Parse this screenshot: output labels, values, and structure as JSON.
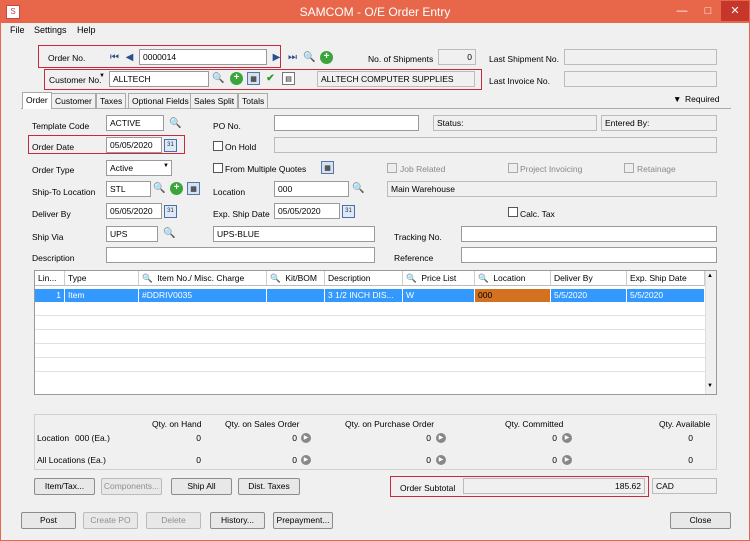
{
  "window": {
    "title": "SAMCOM - O/E Order Entry",
    "minimize": "—",
    "maximize": "□",
    "close": "✕"
  },
  "menu": {
    "file": "File",
    "settings": "Settings",
    "help": "Help"
  },
  "header": {
    "order_no_label": "Order No.",
    "order_no": "0000014",
    "shipments_label": "No. of Shipments",
    "shipments": "0",
    "last_shipment_label": "Last Shipment No.",
    "last_shipment": "",
    "customer_label": "Customer No.",
    "customer_no": "ALLTECH",
    "customer_name": "ALLTECH COMPUTER SUPPLIES",
    "last_invoice_label": "Last Invoice No.",
    "last_invoice": ""
  },
  "tabs": [
    "Order",
    "Customer",
    "Taxes",
    "Optional Fields",
    "Sales Split",
    "Totals"
  ],
  "required_label": "Required",
  "form": {
    "template_label": "Template Code",
    "template": "ACTIVE",
    "po_label": "PO No.",
    "po": "",
    "status_label": "Status:",
    "status": "",
    "entered_label": "Entered By:",
    "entered": "",
    "order_date_label": "Order Date",
    "order_date": "05/05/2020",
    "on_hold_label": "On Hold",
    "order_type_label": "Order Type",
    "order_type": "Active",
    "multiple_quotes_label": "From Multiple Quotes",
    "job_related_label": "Job Related",
    "project_invoicing_label": "Project Invoicing",
    "retainage_label": "Retainage",
    "ship_to_label": "Ship-To Location",
    "ship_to": "STL",
    "location_label": "Location",
    "location": "000",
    "location_name": "Main Warehouse",
    "deliver_by_label": "Deliver By",
    "deliver_by": "05/05/2020",
    "exp_ship_label": "Exp. Ship Date",
    "exp_ship": "05/05/2020",
    "calc_tax_label": "Calc. Tax",
    "ship_via_label": "Ship Via",
    "ship_via": "UPS",
    "ship_via_name": "UPS-BLUE",
    "tracking_label": "Tracking No.",
    "tracking": "",
    "description_label": "Description",
    "description": "",
    "reference_label": "Reference",
    "reference": ""
  },
  "grid": {
    "headers": [
      "Lin...",
      "Type",
      "Item No./ Misc. Charge",
      "Kit/BOM",
      "Description",
      "Price List",
      "Location",
      "Deliver By",
      "Exp. Ship Date"
    ],
    "row": {
      "line": "1",
      "type": "Item",
      "item": "#DDRIV0035",
      "kit": "",
      "description": "3 1/2 INCH DIS...",
      "price_list": "W",
      "location": "000",
      "deliver_by": "5/5/2020",
      "exp_ship": "5/5/2020"
    }
  },
  "qty": {
    "headers": [
      "Qty. on Hand",
      "Qty. on Sales Order",
      "Qty. on Purchase Order",
      "Qty. Committed",
      "Qty. Available"
    ],
    "location_label": "Location",
    "location_value": "000 (Ea.)",
    "all_label": "All Locations (Ea.)",
    "location_row": [
      "0",
      "0",
      "0",
      "0",
      "0"
    ],
    "all_row": [
      "0",
      "0",
      "0",
      "0",
      "0"
    ]
  },
  "buttons1": {
    "item_tax": "Item/Tax...",
    "components": "Components...",
    "ship_all": "Ship All",
    "dist_taxes": "Dist. Taxes"
  },
  "subtotal": {
    "label": "Order Subtotal",
    "value": "185.62",
    "currency": "CAD"
  },
  "buttons2": {
    "post": "Post",
    "create_po": "Create PO",
    "delete": "Delete",
    "history": "History...",
    "prepayment": "Prepayment...",
    "close": "Close"
  }
}
